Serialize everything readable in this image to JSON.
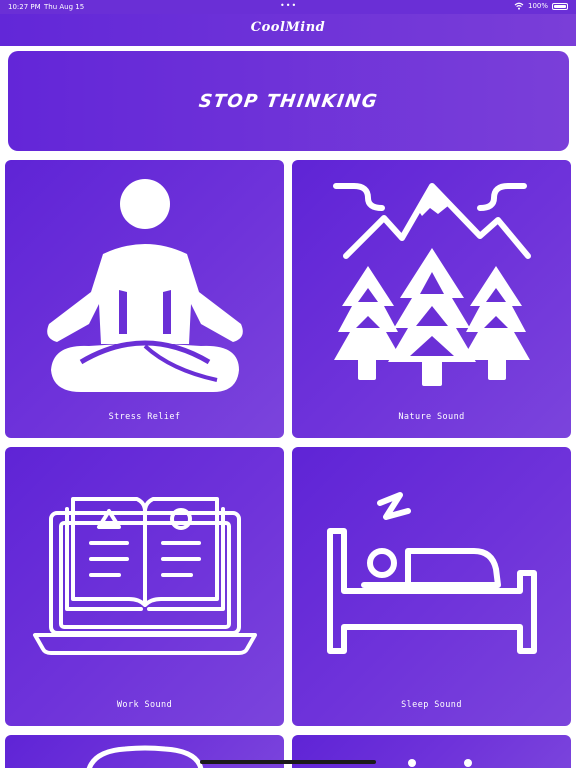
{
  "status_bar": {
    "time": "10:27 PM",
    "date": "Thu Aug 15",
    "dots": "•••",
    "battery": "100%"
  },
  "nav": {
    "title": "CoolMind"
  },
  "banner": {
    "text": "STOP THINKING"
  },
  "cards": [
    {
      "label": "Stress Relief",
      "icon": "meditation-icon"
    },
    {
      "label": "Nature Sound",
      "icon": "mountain-trees-icon"
    },
    {
      "label": "Work Sound",
      "icon": "laptop-book-icon"
    },
    {
      "label": "Sleep Sound",
      "icon": "bed-sleep-icon"
    }
  ],
  "colors": {
    "primary": "#6a2fd6",
    "gradient_start": "#5f24d6",
    "gradient_end": "#7b44dc",
    "text": "#ffffff"
  }
}
